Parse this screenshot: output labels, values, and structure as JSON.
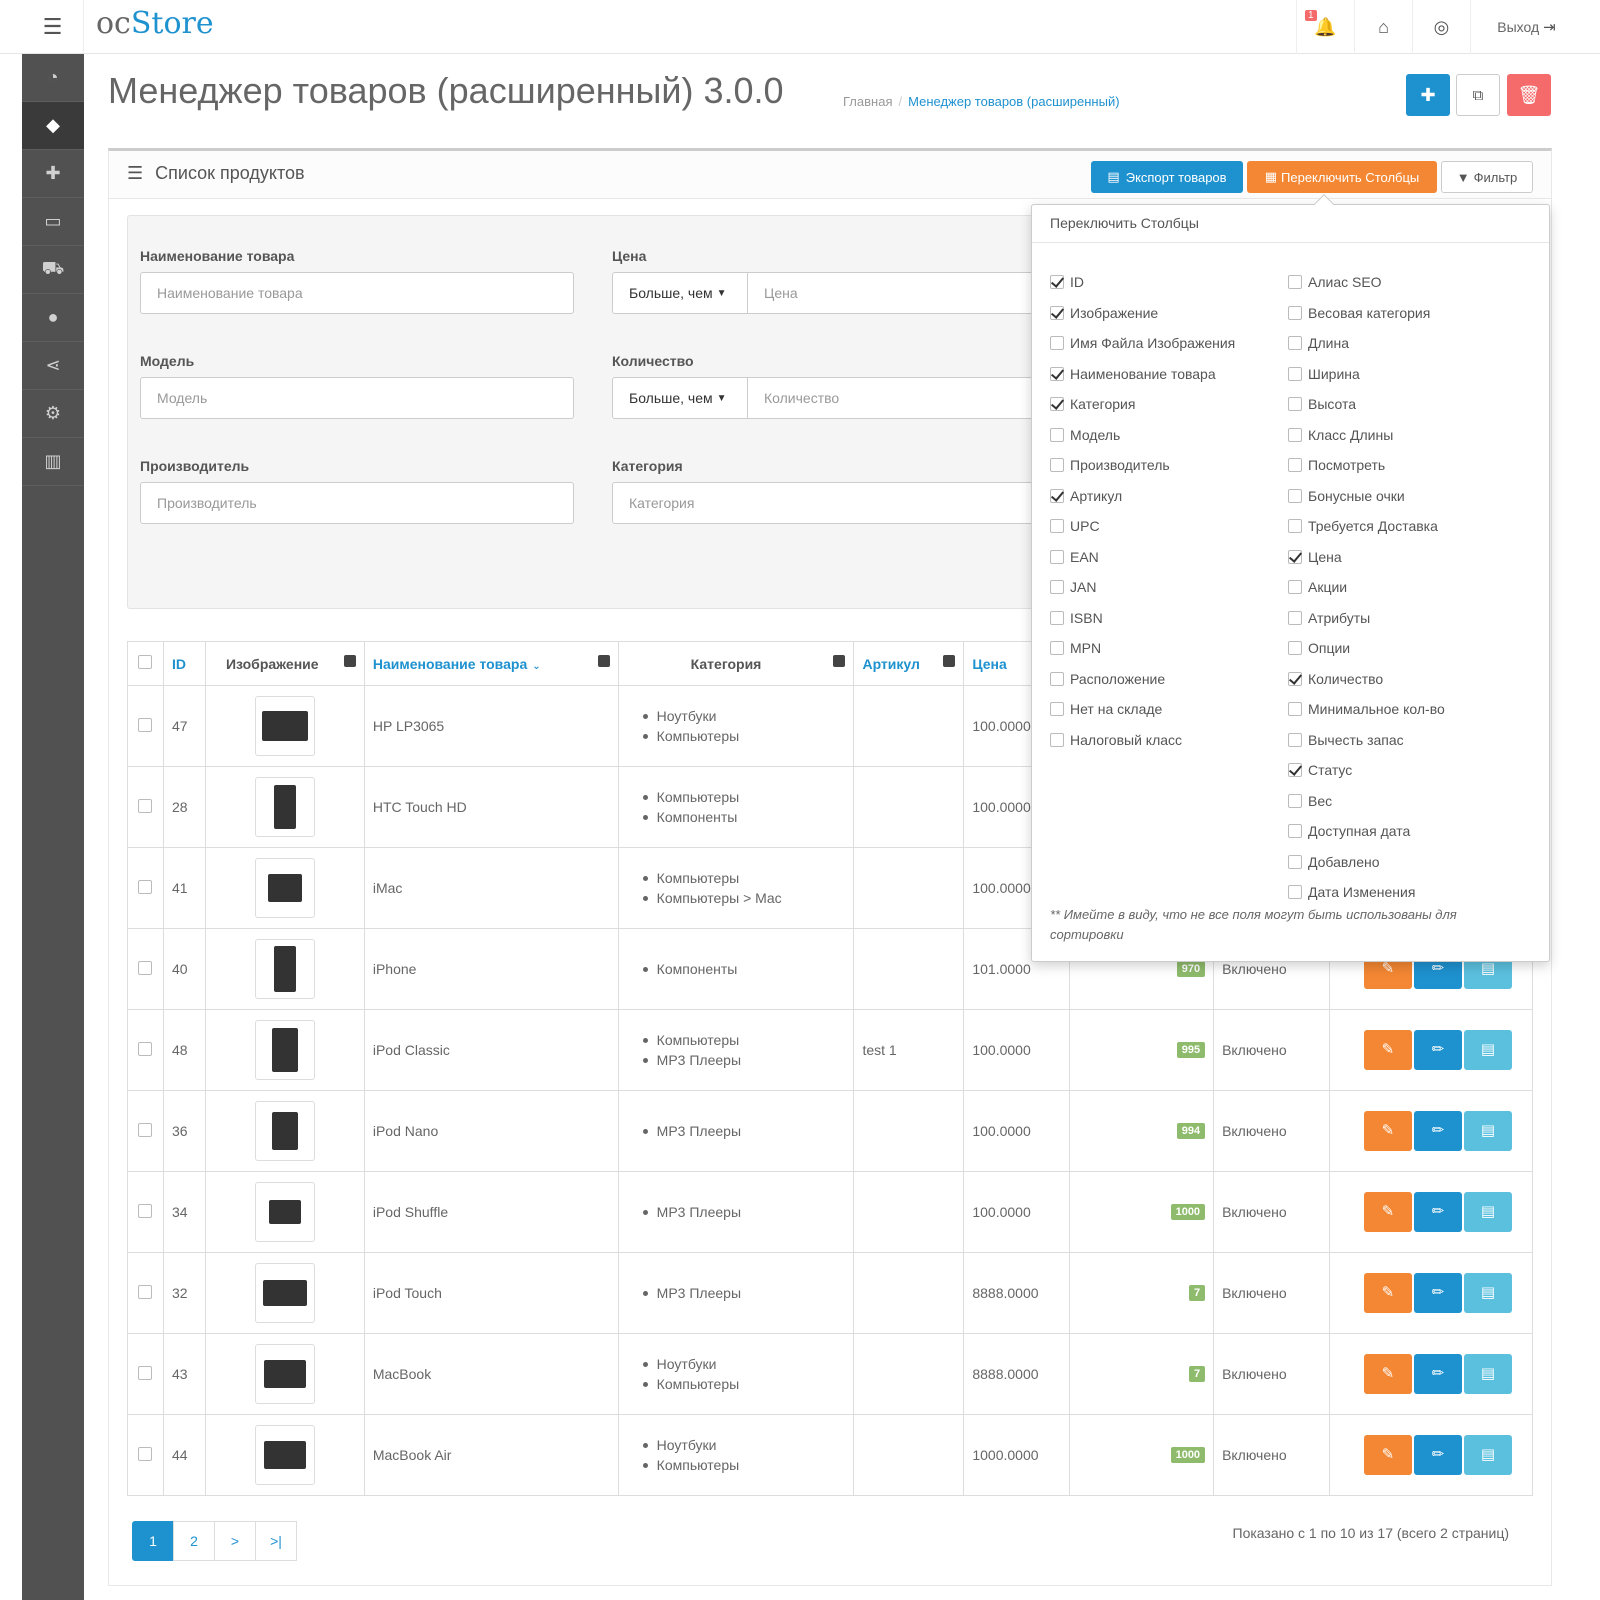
{
  "header": {
    "logo_oc": "oc",
    "logo_store": "Store",
    "notification_count": "1",
    "logout_label": "Выход"
  },
  "page": {
    "title": "Менеджер товаров (расширенный) 3.0.0",
    "breadcrumb_home": "Главная",
    "breadcrumb_current": "Менеджер товаров (расширенный)"
  },
  "panel": {
    "title": "Список продуктов",
    "export_label": "Экспорт товаров",
    "toggle_label": "Переключить Столбцы",
    "filter_label": "Фильтр"
  },
  "filter": {
    "name_label": "Наименование товара",
    "name_placeholder": "Наименование товара",
    "price_label": "Цена",
    "price_op": "Больше, чем",
    "price_placeholder": "Цена",
    "model_label": "Модель",
    "model_placeholder": "Модель",
    "quantity_label": "Количество",
    "quantity_op": "Больше, чем",
    "quantity_placeholder": "Количество",
    "manufacturer_label": "Производитель",
    "manufacturer_placeholder": "Производитель",
    "category_label": "Категория",
    "category_placeholder": "Категория"
  },
  "table": {
    "headers": {
      "id": "ID",
      "image": "Изображение",
      "name": "Наименование товара",
      "category": "Категория",
      "sku": "Артикул",
      "price": "Цена"
    },
    "rows": [
      {
        "id": "47",
        "name": "HP LP3065",
        "cats": [
          "Ноутбуки",
          "Компьютеры"
        ],
        "sku": "",
        "price": "100.0000",
        "qty": "",
        "status": ""
      },
      {
        "id": "28",
        "name": "HTC Touch HD",
        "cats": [
          "Компьютеры",
          "Компоненты"
        ],
        "sku": "",
        "price": "100.0000",
        "qty": "",
        "status": ""
      },
      {
        "id": "41",
        "name": "iMac",
        "cats": [
          "Компьютеры",
          "Компьютеры > Mac"
        ],
        "sku": "",
        "price": "100.0000",
        "qty": "",
        "status": ""
      },
      {
        "id": "40",
        "name": "iPhone",
        "cats": [
          "Компоненты"
        ],
        "sku": "",
        "price": "101.0000",
        "qty": "970",
        "status": "Включено"
      },
      {
        "id": "48",
        "name": "iPod Classic",
        "cats": [
          "Компьютеры",
          "MP3 Плееры"
        ],
        "sku": "test 1",
        "price": "100.0000",
        "qty": "995",
        "status": "Включено"
      },
      {
        "id": "36",
        "name": "iPod Nano",
        "cats": [
          "MP3 Плееры"
        ],
        "sku": "",
        "price": "100.0000",
        "qty": "994",
        "status": "Включено"
      },
      {
        "id": "34",
        "name": "iPod Shuffle",
        "cats": [
          "MP3 Плееры"
        ],
        "sku": "",
        "price": "100.0000",
        "qty": "1000",
        "status": "Включено"
      },
      {
        "id": "32",
        "name": "iPod Touch",
        "cats": [
          "MP3 Плееры"
        ],
        "sku": "",
        "price": "8888.0000",
        "qty": "7",
        "status": "Включено"
      },
      {
        "id": "43",
        "name": "MacBook",
        "cats": [
          "Ноутбуки",
          "Компьютеры"
        ],
        "sku": "",
        "price": "8888.0000",
        "qty": "7",
        "status": "Включено"
      },
      {
        "id": "44",
        "name": "MacBook Air",
        "cats": [
          "Ноутбуки",
          "Компьютеры"
        ],
        "sku": "",
        "price": "1000.0000",
        "qty": "1000",
        "status": "Включено"
      }
    ]
  },
  "pagination": {
    "pages": [
      "1",
      "2",
      ">",
      ">|"
    ],
    "info": "Показано с 1 по 10 из 17 (всего 2 страниц)"
  },
  "columns_dropdown": {
    "title": "Переключить Столбцы",
    "left": [
      {
        "label": "ID",
        "checked": true
      },
      {
        "label": "Изображение",
        "checked": true
      },
      {
        "label": "Имя Файла Изображения",
        "checked": false
      },
      {
        "label": "Наименование товара",
        "checked": true
      },
      {
        "label": "Категория",
        "checked": true
      },
      {
        "label": "Модель",
        "checked": false
      },
      {
        "label": "Производитель",
        "checked": false
      },
      {
        "label": "Артикул",
        "checked": true
      },
      {
        "label": "UPC",
        "checked": false
      },
      {
        "label": "EAN",
        "checked": false
      },
      {
        "label": "JAN",
        "checked": false
      },
      {
        "label": "ISBN",
        "checked": false
      },
      {
        "label": "MPN",
        "checked": false
      },
      {
        "label": "Расположение",
        "checked": false
      },
      {
        "label": "Нет на складе",
        "checked": false
      },
      {
        "label": "Налоговый класс",
        "checked": false
      }
    ],
    "right": [
      {
        "label": "Алиас SEO",
        "checked": false
      },
      {
        "label": "Весовая категория",
        "checked": false
      },
      {
        "label": "Длина",
        "checked": false
      },
      {
        "label": "Ширина",
        "checked": false
      },
      {
        "label": "Высота",
        "checked": false
      },
      {
        "label": "Класс Длины",
        "checked": false
      },
      {
        "label": "Посмотреть",
        "checked": false
      },
      {
        "label": "Бонусные очки",
        "checked": false
      },
      {
        "label": "Требуется Доставка",
        "checked": false
      },
      {
        "label": "Цена",
        "checked": true
      },
      {
        "label": "Акции",
        "checked": false
      },
      {
        "label": "Атрибуты",
        "checked": false
      },
      {
        "label": "Опции",
        "checked": false
      },
      {
        "label": "Количество",
        "checked": true
      },
      {
        "label": "Минимальное кол-во",
        "checked": false
      },
      {
        "label": "Вычесть запас",
        "checked": false
      },
      {
        "label": "Статус",
        "checked": true
      },
      {
        "label": "Вес",
        "checked": false
      },
      {
        "label": "Доступная дата",
        "checked": false
      },
      {
        "label": "Добавлено",
        "checked": false
      },
      {
        "label": "Дата Изменения",
        "checked": false
      }
    ],
    "note": "** Имейте в виду, что не все поля могут быть использованы для сортировки"
  }
}
